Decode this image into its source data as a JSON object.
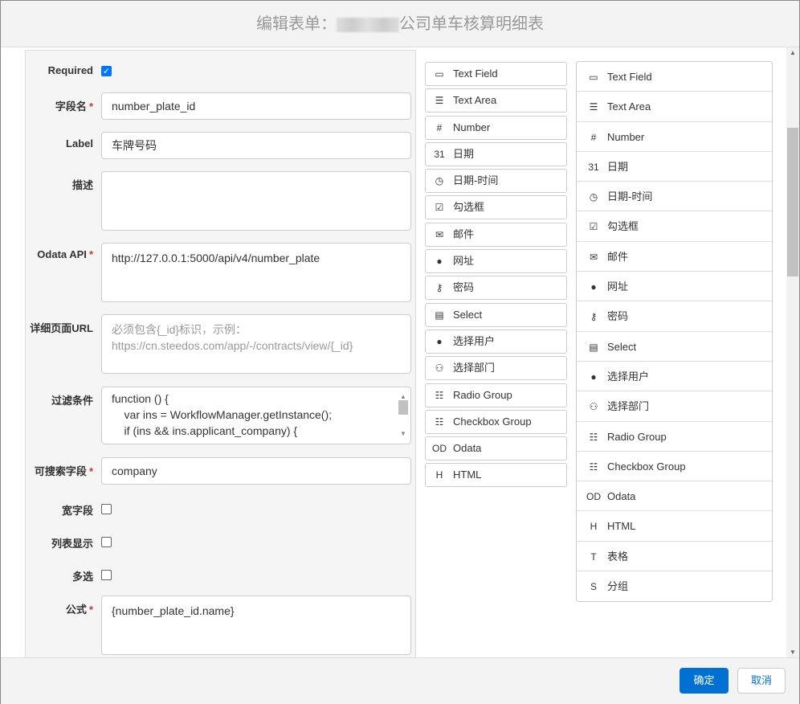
{
  "header": {
    "title_prefix": "编辑表单：",
    "title_suffix": "公司单车核算明细表"
  },
  "form": {
    "required_label": "Required",
    "required_checked": true,
    "field_name_label": "字段名",
    "field_name_value": "number_plate_id",
    "label_label": "Label",
    "label_value": "车牌号码",
    "desc_label": "描述",
    "desc_value": "",
    "odata_label": "Odata API",
    "odata_value": "http://127.0.0.1:5000/api/v4/number_plate",
    "detail_url_label": "详细页面URL",
    "detail_url_placeholder": "必须包含{_id}标识，示例：\nhttps://cn.steedos.com/app/-/contracts/view/{_id}",
    "filter_label": "过滤条件",
    "filter_value": "function () {\n    var ins = WorkflowManager.getInstance();\n    if (ins && ins.applicant_company) {",
    "searchable_label": "可搜索字段",
    "searchable_value": "company",
    "wide_label": "宽字段",
    "list_label": "列表显示",
    "multi_label": "多选",
    "formula_label": "公式",
    "formula_value": "{number_plate_id.name}"
  },
  "palette_mid": [
    {
      "icon": "text-field-icon",
      "glyph": "▭",
      "label": "Text Field"
    },
    {
      "icon": "text-area-icon",
      "glyph": "☰",
      "label": "Text Area"
    },
    {
      "icon": "number-icon",
      "glyph": "#",
      "label": "Number"
    },
    {
      "icon": "calendar-icon",
      "glyph": "31",
      "label": "日期"
    },
    {
      "icon": "clock-icon",
      "glyph": "◷",
      "label": "日期-时间"
    },
    {
      "icon": "checkbox-icon",
      "glyph": "☑",
      "label": "勾选框"
    },
    {
      "icon": "mail-icon",
      "glyph": "✉",
      "label": "邮件"
    },
    {
      "icon": "globe-icon",
      "glyph": "●",
      "label": "网址"
    },
    {
      "icon": "key-icon",
      "glyph": "⚷",
      "label": "密码"
    },
    {
      "icon": "select-icon",
      "glyph": "▤",
      "label": "Select"
    },
    {
      "icon": "user-icon",
      "glyph": "●",
      "label": "选择用户"
    },
    {
      "icon": "group-icon",
      "glyph": "⚇",
      "label": "选择部门"
    },
    {
      "icon": "radio-group-icon",
      "glyph": "☷",
      "label": "Radio Group"
    },
    {
      "icon": "checkbox-group-icon",
      "glyph": "☷",
      "label": "Checkbox Group"
    },
    {
      "icon": "odata-icon",
      "glyph": "OD",
      "label": "Odata"
    },
    {
      "icon": "html-icon",
      "glyph": "H",
      "label": "HTML"
    }
  ],
  "palette_right": [
    {
      "icon": "text-field-icon",
      "glyph": "▭",
      "label": "Text Field"
    },
    {
      "icon": "text-area-icon",
      "glyph": "☰",
      "label": "Text Area"
    },
    {
      "icon": "number-icon",
      "glyph": "#",
      "label": "Number"
    },
    {
      "icon": "calendar-icon",
      "glyph": "31",
      "label": "日期"
    },
    {
      "icon": "clock-icon",
      "glyph": "◷",
      "label": "日期-时间"
    },
    {
      "icon": "checkbox-icon",
      "glyph": "☑",
      "label": "勾选框"
    },
    {
      "icon": "mail-icon",
      "glyph": "✉",
      "label": "邮件"
    },
    {
      "icon": "globe-icon",
      "glyph": "●",
      "label": "网址"
    },
    {
      "icon": "key-icon",
      "glyph": "⚷",
      "label": "密码"
    },
    {
      "icon": "select-icon",
      "glyph": "▤",
      "label": "Select"
    },
    {
      "icon": "user-icon",
      "glyph": "●",
      "label": "选择用户"
    },
    {
      "icon": "group-icon",
      "glyph": "⚇",
      "label": "选择部门"
    },
    {
      "icon": "radio-group-icon",
      "glyph": "☷",
      "label": "Radio Group"
    },
    {
      "icon": "checkbox-group-icon",
      "glyph": "☷",
      "label": "Checkbox Group"
    },
    {
      "icon": "odata-icon",
      "glyph": "OD",
      "label": "Odata"
    },
    {
      "icon": "html-icon",
      "glyph": "H",
      "label": "HTML"
    },
    {
      "icon": "table-icon",
      "glyph": "T",
      "label": "表格"
    },
    {
      "icon": "section-icon",
      "glyph": "S",
      "label": "分组"
    }
  ],
  "footer": {
    "ok": "确定",
    "cancel": "取消"
  },
  "colors": {
    "primary": "#0070d2",
    "required": "#c23934"
  }
}
